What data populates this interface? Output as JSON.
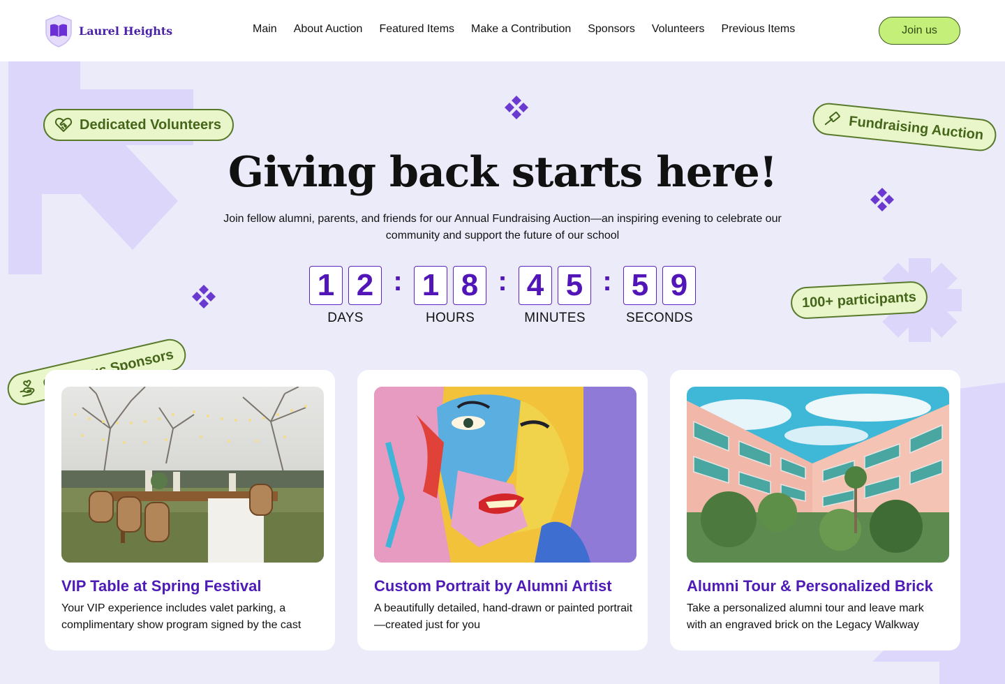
{
  "brand": {
    "name": "Laurel Heights"
  },
  "nav": {
    "items": [
      "Main",
      "About Auction",
      "Featured Items",
      "Make a Contribution",
      "Sponsors",
      "Volunteers",
      "Previous Items"
    ],
    "join_label": "Join us"
  },
  "hero": {
    "title": "Giving back starts here!",
    "subtitle": "Join fellow alumni, parents, and friends for our Annual Fundraising Auction—an inspiring evening to celebrate our community and support the future of our school"
  },
  "countdown": {
    "separator": ":",
    "days": {
      "d1": "1",
      "d2": "2",
      "label": "DAYS"
    },
    "hours": {
      "d1": "1",
      "d2": "8",
      "label": "HOURS"
    },
    "minutes": {
      "d1": "4",
      "d2": "5",
      "label": "MINUTES"
    },
    "seconds": {
      "d1": "5",
      "d2": "9",
      "label": "SECONDS"
    }
  },
  "pills": {
    "volunteers": "Dedicated Volunteers",
    "auction": "Fundraising Auction",
    "participants": "100+ participants",
    "sponsors": "Generous Sponsors"
  },
  "cards": [
    {
      "title": "VIP Table at Spring Festival",
      "description": "Your VIP experience includes valet parking, a complimentary show program signed by the cast"
    },
    {
      "title": "Custom Portrait by Alumni Artist",
      "description": "A beautifully detailed, hand-drawn or painted portrait—created just for you"
    },
    {
      "title": "Alumni Tour & Personalized Brick",
      "description": "Take a personalized alumni tour and leave mark with an engraved brick on the Legacy Walkway"
    }
  ],
  "colors": {
    "accent": "#5216b8",
    "pill_bg": "#e8f6c9",
    "join_bg": "#c4ef79",
    "page_bg": "#ecebfa"
  },
  "icons": [
    "shield-book-icon",
    "heart-handshake-icon",
    "gavel-icon",
    "hands-heart-icon",
    "sparkle-icon"
  ]
}
